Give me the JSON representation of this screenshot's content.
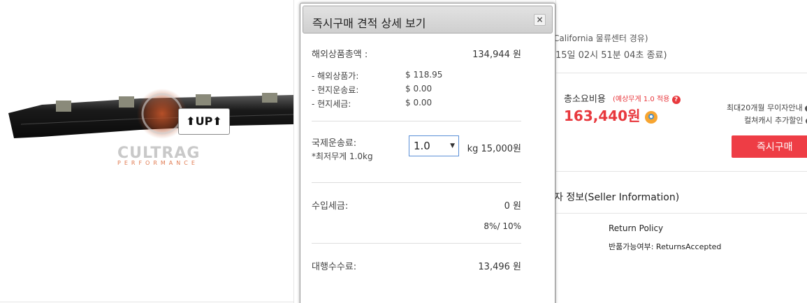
{
  "product_image": {
    "logo_text": "CULTRAG",
    "logo_sub": "PERFORMANCE",
    "label_text": "UP"
  },
  "modal": {
    "title": "즉시구매 견적 상세 보기",
    "close_label": "×",
    "total_label": "해외상품총액 :",
    "total_value": "134,944 원",
    "breakdown": [
      {
        "label": "- 해외상품가:",
        "value": "$ 118.95"
      },
      {
        "label": "- 현지운송료:",
        "value": "$ 0.00"
      },
      {
        "label": "- 현지세금:",
        "value": "$ 0.00"
      }
    ],
    "shipping_label": "국제운송료:",
    "shipping_note": "*최저무게 1.0kg",
    "weight_value": "1.0",
    "shipping_value": "kg 15,000원",
    "import_tax_label": "수입세금:",
    "import_tax_value": "0 원",
    "import_tax_rate": "8%/ 10%",
    "agency_fee_label": "대행수수료:",
    "agency_fee_value": "13,496 원"
  },
  "right_panel": {
    "route_text": "California 물류센터 경유)",
    "time_text": "15일 02시 51분 04초 종료)",
    "total_cost_label": "총소요비용",
    "weight_note": "(예상무게 1.0 적용",
    "help_icon": "?",
    "price": "163,440원",
    "installment_text": "최대20개월 무이자안내",
    "cashback_text": "컬쳐캐시 추가할인",
    "buy_button": "즉시구매",
    "seller_title": "자 정보(Seller Information)",
    "return_policy_title": "Return Policy",
    "return_policy_value": "반품가능여부: ReturnsAccepted"
  },
  "colors": {
    "accent_red": "#e8383d",
    "button_red": "#ee3d45",
    "select_border": "#5b8fd6"
  }
}
